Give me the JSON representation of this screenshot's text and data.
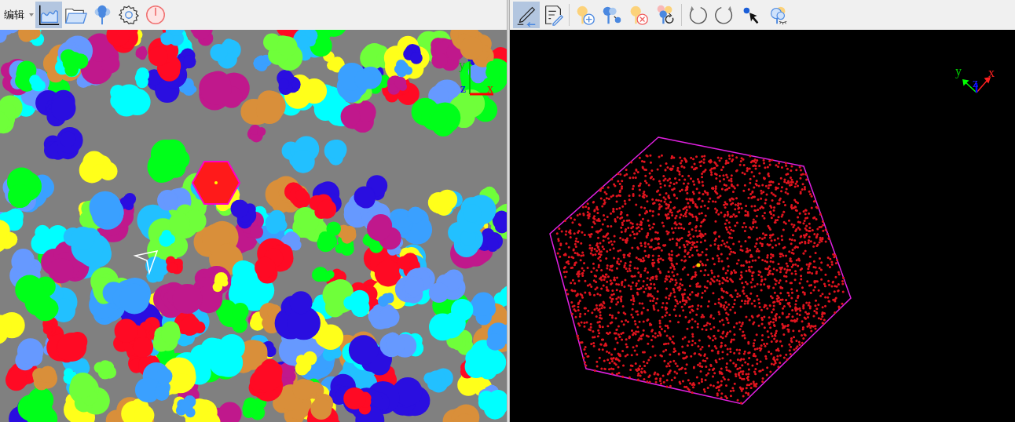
{
  "left_toolbar": {
    "mode": "编辑",
    "tools": [
      {
        "kind": "chart",
        "selected": true
      },
      {
        "kind": "folder",
        "selected": false
      },
      {
        "kind": "tree",
        "selected": false
      },
      {
        "kind": "gear",
        "selected": false
      },
      {
        "kind": "power",
        "selected": false
      }
    ]
  },
  "right_toolbar": {
    "tools": [
      {
        "kind": "pencil-undo",
        "selected": true
      },
      {
        "kind": "doc-edit",
        "selected": false
      },
      {
        "kind": "separator"
      },
      {
        "kind": "tree-add",
        "selected": false
      },
      {
        "kind": "tree-move",
        "selected": false
      },
      {
        "kind": "tree-delete",
        "selected": false
      },
      {
        "kind": "tree-refresh",
        "selected": false
      },
      {
        "kind": "separator"
      },
      {
        "kind": "undo",
        "selected": false
      },
      {
        "kind": "redo",
        "selected": false
      },
      {
        "kind": "pointer",
        "selected": false
      },
      {
        "kind": "cloud-hide",
        "selected": false
      }
    ]
  },
  "left_view": {
    "axis_labels": [
      "y",
      "z",
      "x"
    ]
  },
  "right_view": {
    "axis_labels": [
      "y",
      "z",
      "x"
    ]
  }
}
